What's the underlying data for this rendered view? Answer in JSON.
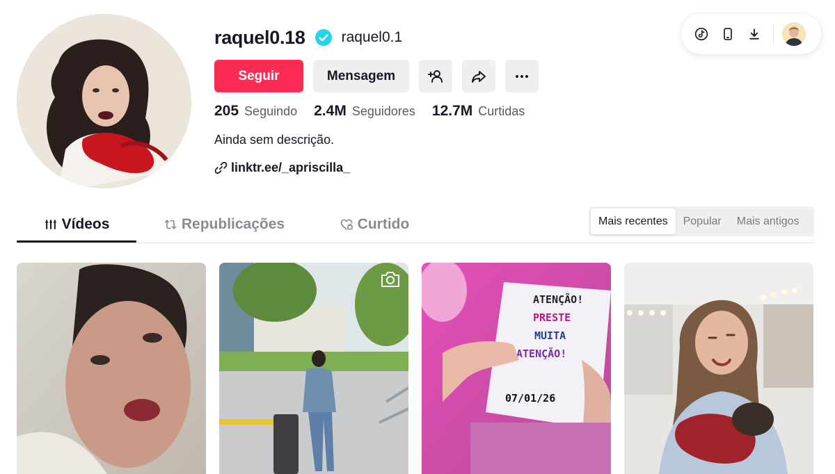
{
  "profile": {
    "username": "raquel0.18",
    "nickname": "raquel0.1",
    "bio": "Ainda sem descrição.",
    "link": "linktr.ee/_apriscilla_",
    "verified": true
  },
  "actions": {
    "follow_label": "Seguir",
    "message_label": "Mensagem",
    "icons": [
      "add-friend-icon",
      "share-icon",
      "more-icon"
    ]
  },
  "stats": [
    {
      "value": "205",
      "label": "Seguindo"
    },
    {
      "value": "2.4M",
      "label": "Seguidores"
    },
    {
      "value": "12.7M",
      "label": "Curtidas"
    }
  ],
  "toolbar": {
    "icons": [
      "tiktok-icon",
      "mobile-icon",
      "download-icon",
      "user-avatar"
    ]
  },
  "tabs": [
    {
      "label": "Vídeos",
      "icon": "grid-bars-icon",
      "active": true
    },
    {
      "label": "Republicações",
      "icon": "repost-icon",
      "active": false
    },
    {
      "label": "Curtido",
      "icon": "heart-lock-icon",
      "active": false
    }
  ],
  "sort": {
    "options": [
      "Mais recentes",
      "Popular",
      "Mais antigos"
    ],
    "selected": "Mais recentes"
  },
  "videos": [
    {
      "type": "video",
      "badge": null
    },
    {
      "type": "photo",
      "badge": "camera-icon"
    },
    {
      "type": "video",
      "badge": null
    },
    {
      "type": "video",
      "badge": null
    }
  ],
  "colors": {
    "accent": "#fe2c55",
    "verified": "#20d5ec",
    "text": "#161823",
    "muted": "#5b5c62",
    "button_bg": "#efeff0"
  }
}
